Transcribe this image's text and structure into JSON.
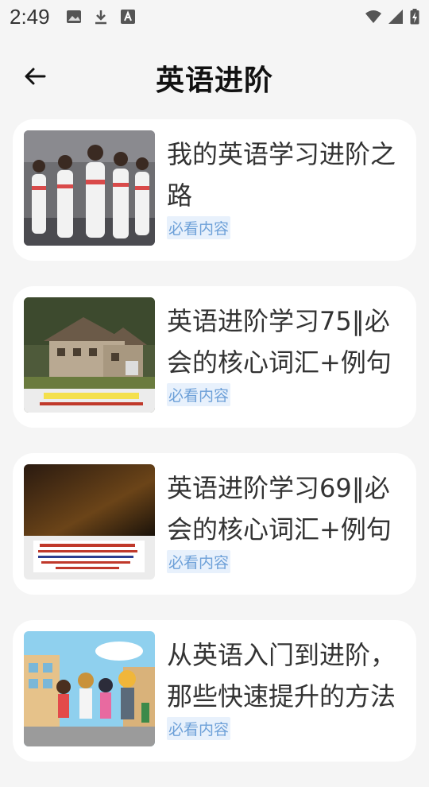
{
  "status_bar": {
    "time": "2:49",
    "icons": [
      "image-icon",
      "download-icon",
      "text-icon",
      "wifi-icon",
      "signal-icon",
      "battery-icon"
    ]
  },
  "header": {
    "title": "英语进阶",
    "back_icon": "arrow-left-icon"
  },
  "cards": [
    {
      "title": "我的英语学习进阶之路",
      "tag": "必看内容",
      "thumb": "dancers"
    },
    {
      "title": "英语进阶学习75‖必会的核心词汇+例句",
      "tag": "必看内容",
      "thumb": "house"
    },
    {
      "title": "英语进阶学习69‖必会的核心词汇+例句",
      "tag": "必看内容",
      "thumb": "dark"
    },
    {
      "title": "从英语入门到进阶，那些快速提升的方法",
      "tag": "必看内容",
      "thumb": "anime"
    }
  ],
  "colors": {
    "tag_text": "#6da0d8",
    "tag_bg": "#e8f1fc",
    "card_bg": "#ffffff",
    "page_bg": "#f5f5f5"
  }
}
